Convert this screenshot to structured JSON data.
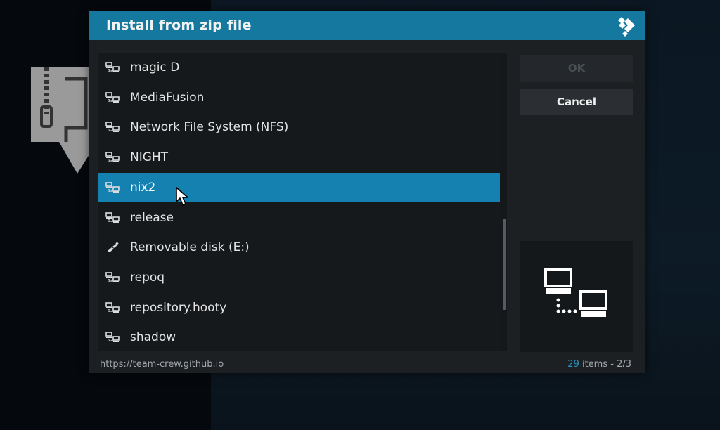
{
  "dialog": {
    "title": "Install from zip file",
    "items": [
      {
        "label": "magic D",
        "icon": "network-share-icon"
      },
      {
        "label": "MediaFusion",
        "icon": "network-share-icon"
      },
      {
        "label": "Network File System (NFS)",
        "icon": "network-share-icon"
      },
      {
        "label": "NIGHT",
        "icon": "network-share-icon"
      },
      {
        "label": "nix2",
        "icon": "network-share-icon",
        "selected": true
      },
      {
        "label": "release",
        "icon": "network-share-icon"
      },
      {
        "label": "Removable disk (E:)",
        "icon": "usb-drive-icon"
      },
      {
        "label": "repoq",
        "icon": "network-share-icon"
      },
      {
        "label": "repository.hooty",
        "icon": "network-share-icon"
      },
      {
        "label": "shadow",
        "icon": "network-share-icon"
      }
    ],
    "buttons": {
      "ok": "OK",
      "cancel": "Cancel"
    },
    "footer": {
      "url": "https://team-crew.github.io",
      "count": "29",
      "count_suffix": " items - 2/3"
    }
  },
  "colors": {
    "header": "#14789f",
    "selection": "#1481b1",
    "dialog_bg": "#1d2023",
    "count_accent": "#2d8fbf"
  }
}
